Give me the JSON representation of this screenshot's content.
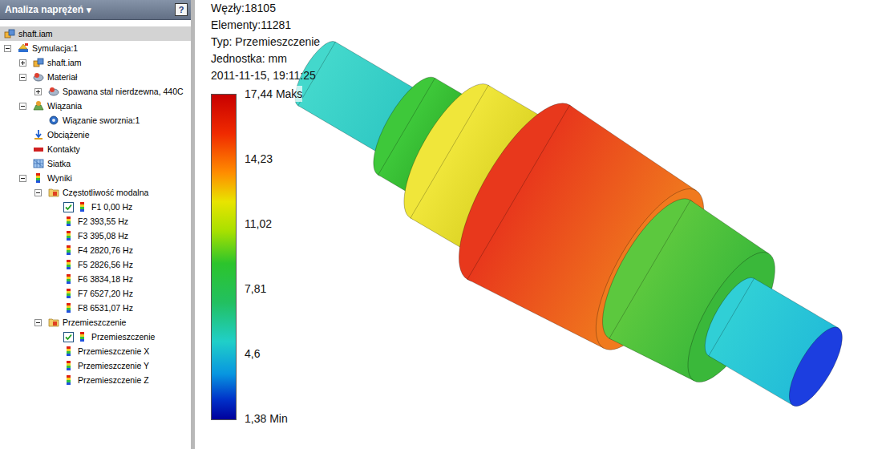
{
  "panel": {
    "title": "Analiza naprężeń",
    "dropdown": "▾",
    "help": "?"
  },
  "tree": [
    {
      "label": "shaft.iam",
      "depth": 0,
      "kind": "assembly",
      "expandable": false,
      "expanded": false,
      "checked": false,
      "selected": true
    },
    {
      "label": "Symulacja:1",
      "depth": 0,
      "kind": "simulation",
      "expandable": true,
      "expanded": true,
      "checked": false,
      "selected": false
    },
    {
      "label": "shaft.iam",
      "depth": 1,
      "kind": "assembly",
      "expandable": true,
      "expanded": false,
      "checked": false,
      "selected": false
    },
    {
      "label": "Materiał",
      "depth": 1,
      "kind": "material",
      "expandable": true,
      "expanded": true,
      "checked": false,
      "selected": false
    },
    {
      "label": "Spawana stal nierdzewna, 440C",
      "depth": 2,
      "kind": "material",
      "expandable": true,
      "expanded": false,
      "checked": false,
      "selected": false
    },
    {
      "label": "Wiązania",
      "depth": 1,
      "kind": "constraint",
      "expandable": true,
      "expanded": true,
      "checked": false,
      "selected": false
    },
    {
      "label": "Wiązanie sworznia:1",
      "depth": 2,
      "kind": "pin",
      "expandable": false,
      "expanded": false,
      "checked": false,
      "selected": false
    },
    {
      "label": "Obciążenie",
      "depth": 1,
      "kind": "load",
      "expandable": false,
      "expanded": false,
      "checked": false,
      "selected": false
    },
    {
      "label": "Kontakty",
      "depth": 1,
      "kind": "contact",
      "expandable": false,
      "expanded": false,
      "checked": false,
      "selected": false
    },
    {
      "label": "Siatka",
      "depth": 1,
      "kind": "mesh",
      "expandable": false,
      "expanded": false,
      "checked": false,
      "selected": false
    },
    {
      "label": "Wyniki",
      "depth": 1,
      "kind": "result",
      "expandable": true,
      "expanded": true,
      "checked": false,
      "selected": false
    },
    {
      "label": "Częstotliwość modalna",
      "depth": 2,
      "kind": "folder",
      "expandable": true,
      "expanded": true,
      "checked": false,
      "selected": false
    },
    {
      "label": "F1 0,00 Hz",
      "depth": 3,
      "kind": "result",
      "expandable": false,
      "expanded": false,
      "checked": true,
      "selected": false
    },
    {
      "label": "F2 393,55 Hz",
      "depth": 3,
      "kind": "result",
      "expandable": false,
      "expanded": false,
      "checked": false,
      "selected": false
    },
    {
      "label": "F3 395,08 Hz",
      "depth": 3,
      "kind": "result",
      "expandable": false,
      "expanded": false,
      "checked": false,
      "selected": false
    },
    {
      "label": "F4 2820,76 Hz",
      "depth": 3,
      "kind": "result",
      "expandable": false,
      "expanded": false,
      "checked": false,
      "selected": false
    },
    {
      "label": "F5 2826,56 Hz",
      "depth": 3,
      "kind": "result",
      "expandable": false,
      "expanded": false,
      "checked": false,
      "selected": false
    },
    {
      "label": "F6 3834,18 Hz",
      "depth": 3,
      "kind": "result",
      "expandable": false,
      "expanded": false,
      "checked": false,
      "selected": false
    },
    {
      "label": "F7 6527,20 Hz",
      "depth": 3,
      "kind": "result",
      "expandable": false,
      "expanded": false,
      "checked": false,
      "selected": false
    },
    {
      "label": "F8 6531,07 Hz",
      "depth": 3,
      "kind": "result",
      "expandable": false,
      "expanded": false,
      "checked": false,
      "selected": false
    },
    {
      "label": "Przemieszczenie",
      "depth": 2,
      "kind": "folder",
      "expandable": true,
      "expanded": true,
      "checked": false,
      "selected": false
    },
    {
      "label": "Przemieszczenie",
      "depth": 3,
      "kind": "result",
      "expandable": false,
      "expanded": false,
      "checked": true,
      "selected": false
    },
    {
      "label": "Przemieszczenie X",
      "depth": 3,
      "kind": "result",
      "expandable": false,
      "expanded": false,
      "checked": false,
      "selected": false
    },
    {
      "label": "Przemieszczenie Y",
      "depth": 3,
      "kind": "result",
      "expandable": false,
      "expanded": false,
      "checked": false,
      "selected": false
    },
    {
      "label": "Przemieszczenie Z",
      "depth": 3,
      "kind": "result",
      "expandable": false,
      "expanded": false,
      "checked": false,
      "selected": false
    }
  ],
  "info": [
    "Węzły:18105",
    "Elementy:11281",
    "Typ: Przemieszczenie",
    "Jednostka: mm",
    "2011-11-15, 19:11:25"
  ],
  "legend": {
    "ticks": [
      "17,44 Maks",
      "14,23",
      "11,02",
      "7,81",
      "4,6",
      "1,38 Min"
    ]
  }
}
